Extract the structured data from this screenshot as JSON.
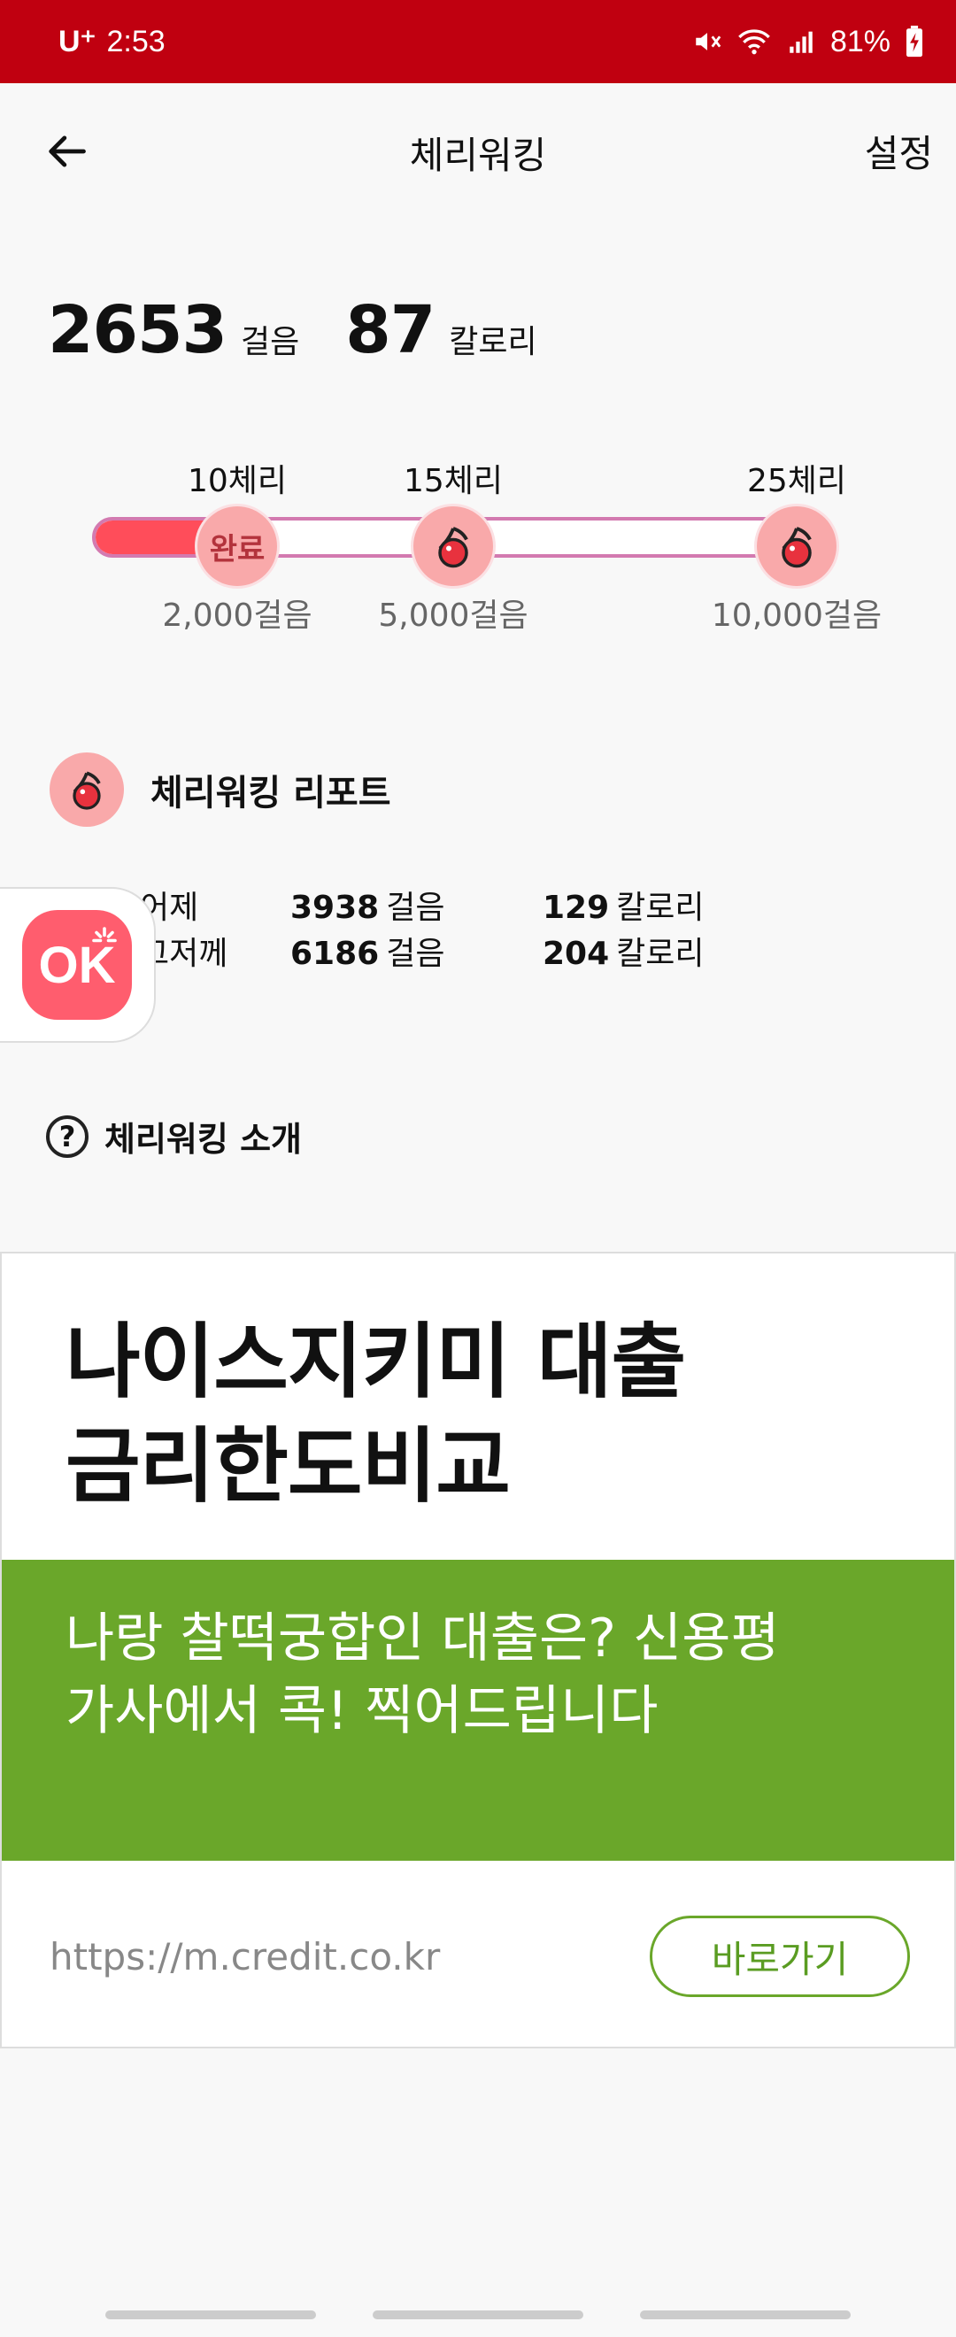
{
  "status_bar": {
    "carrier": "U⁺",
    "time": "2:53",
    "battery": "81%"
  },
  "appbar": {
    "back_icon": "arrow-left-icon",
    "title": "체리워킹",
    "settings": "설정"
  },
  "summary": {
    "steps": "2653",
    "steps_unit": "걸음",
    "calories": "87",
    "calories_unit": "칼로리"
  },
  "progress": {
    "fill_fraction": 0.15,
    "milestones": [
      {
        "reward": "10체리",
        "steps": "2,000걸음",
        "state_label": "완료"
      },
      {
        "reward": "15체리",
        "steps": "5,000걸음"
      },
      {
        "reward": "25체리",
        "steps": "10,000걸음"
      }
    ]
  },
  "report": {
    "title": "체리워킹 리포트",
    "rows": [
      {
        "day": "어제",
        "steps": "3938",
        "steps_unit": "걸음",
        "calories": "129",
        "calories_unit": "칼로리"
      },
      {
        "day": "그저께",
        "steps": "6186",
        "steps_unit": "걸음",
        "calories": "204",
        "calories_unit": "칼로리"
      }
    ]
  },
  "ok_button": {
    "label": "OK"
  },
  "intro": {
    "icon": "?",
    "label": "체리워킹 소개"
  },
  "ad": {
    "headline_1": "나이스지키미 대출",
    "headline_2": "금리한도비교",
    "sub_1": "나랑 찰떡궁합인 대출은? 신용평",
    "sub_2": "가사에서 콕! 찍어드립니다",
    "url": "https://m.credit.co.kr",
    "cta": "바로가기",
    "accent": "#6aa72a"
  },
  "colors": {
    "status_bar": "#c00010",
    "progress_fill": "#ff4d5a",
    "cherry_bg": "#f9a9aa"
  }
}
